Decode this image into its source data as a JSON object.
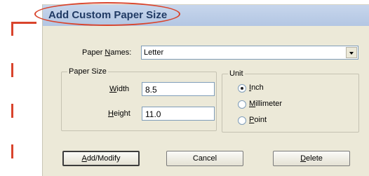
{
  "dialog": {
    "title": "Add Custom Paper Size"
  },
  "paper_names": {
    "label_pre": "Paper ",
    "label_key": "N",
    "label_post": "ames:",
    "value": "Letter"
  },
  "paper_size": {
    "group_title": "Paper Size",
    "width_label_key": "W",
    "width_label_rest": "idth",
    "width_value": "8.5",
    "height_label_key": "H",
    "height_label_rest": "eight",
    "height_value": "11.0"
  },
  "unit": {
    "group_title": "Unit",
    "options": [
      {
        "key": "I",
        "rest": "nch",
        "selected": true
      },
      {
        "key": "M",
        "rest": "illimeter",
        "selected": false
      },
      {
        "key": "P",
        "rest": "oint",
        "selected": false
      }
    ]
  },
  "buttons": {
    "add_modify_key": "A",
    "add_modify_rest": "dd/Modify",
    "cancel": "Cancel",
    "delete_key": "D",
    "delete_rest": "elete"
  },
  "annotation": {
    "color": "#d9442c"
  }
}
